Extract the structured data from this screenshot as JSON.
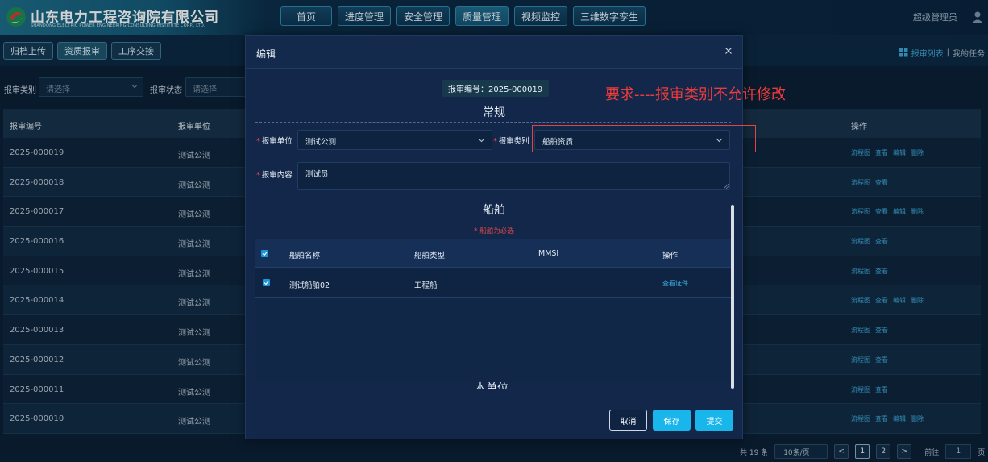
{
  "header": {
    "logo_cn": "山东电力工程咨询院有限公司",
    "logo_en": "SHANDONG ELECTRIC POWER ENGINEERING CONSULTING INSTITUTE CORP., LTD.",
    "nav": [
      "首页",
      "进度管理",
      "安全管理",
      "质量管理",
      "视频监控",
      "三维数字孪生"
    ],
    "user": "超级管理员",
    "colors": {
      "accent": "#2f89b3",
      "link": "#3ea8d8",
      "warning": "#e84141"
    }
  },
  "toolbar": {
    "tabs": [
      "归档上传",
      "资质报审",
      "工序交接"
    ],
    "links": {
      "list": "报审列表",
      "sep": "|",
      "mine": "我的任务"
    }
  },
  "filters": {
    "category_label": "报审类别",
    "category_placeholder": "请选择",
    "status_label": "报审状态",
    "status_placeholder": "请选择"
  },
  "table": {
    "headers": [
      "报审编号",
      "报审单位",
      "操作"
    ],
    "rows": [
      {
        "code": "2025-000019",
        "unit": "测试公测",
        "ops": [
          "流程图",
          "查看",
          "编辑",
          "删除"
        ]
      },
      {
        "code": "2025-000018",
        "unit": "测试公测",
        "ops": [
          "流程图",
          "查看"
        ]
      },
      {
        "code": "2025-000017",
        "unit": "测试公测",
        "ops": [
          "流程图",
          "查看",
          "编辑",
          "删除"
        ]
      },
      {
        "code": "2025-000016",
        "unit": "测试公测",
        "ops": [
          "流程图",
          "查看"
        ]
      },
      {
        "code": "2025-000015",
        "unit": "测试公测",
        "ops": [
          "流程图",
          "查看"
        ]
      },
      {
        "code": "2025-000014",
        "unit": "测试公测",
        "ops": [
          "流程图",
          "查看",
          "编辑",
          "删除"
        ]
      },
      {
        "code": "2025-000013",
        "unit": "测试公测",
        "ops": [
          "流程图",
          "查看"
        ]
      },
      {
        "code": "2025-000012",
        "unit": "测试公测",
        "ops": [
          "流程图",
          "查看"
        ]
      },
      {
        "code": "2025-000011",
        "unit": "测试公测",
        "ops": [
          "流程图",
          "查看"
        ]
      },
      {
        "code": "2025-000010",
        "unit": "测试公测",
        "ops": [
          "流程图",
          "查看",
          "编辑",
          "删除"
        ]
      }
    ]
  },
  "pagination": {
    "total": "共 19 条",
    "page_size": "10条/页",
    "prev": "<",
    "pages": [
      "1",
      "2"
    ],
    "next": ">",
    "goto_label": "前往",
    "goto_value": "1",
    "page_unit": "页"
  },
  "modal": {
    "title": "编辑",
    "code_label": "报审编号：2025-000019",
    "section_general": "常规",
    "unit_label": "报审单位",
    "unit_value": "测试公测",
    "category_label": "报审类别",
    "category_value": "船舶资质",
    "content_label": "报审内容",
    "content_value": "测试员",
    "required_mark": "*",
    "annotation": "要求----报审类别不允许修改",
    "section_ship": "船舶",
    "ship_hint": "* 船舶为必选",
    "ship_headers": [
      "船舶名称",
      "船舶类型",
      "MMSI",
      "操作"
    ],
    "ship_rows": [
      {
        "name": "测试船舶02",
        "type": "工程船",
        "mmsi": "",
        "action": "查看证件"
      }
    ],
    "section_unit": "本单位",
    "buttons": {
      "cancel": "取消",
      "save": "保存",
      "submit": "提交"
    }
  }
}
